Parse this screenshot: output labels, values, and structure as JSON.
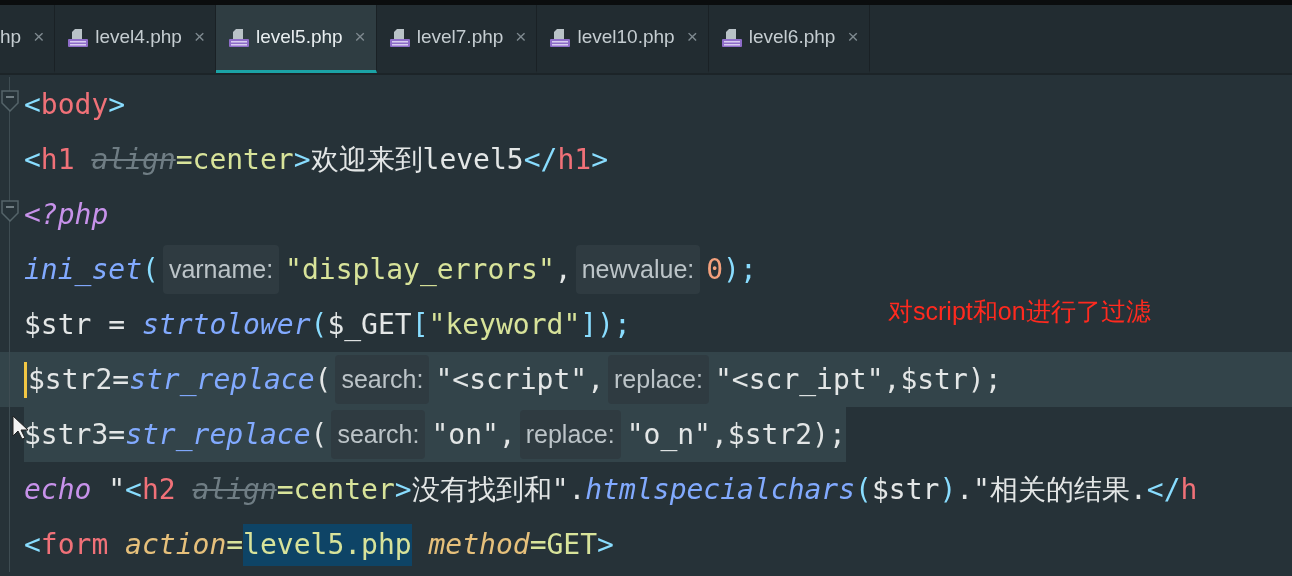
{
  "tabs": [
    {
      "label": "hp",
      "close": "×",
      "selected": false,
      "icon": false
    },
    {
      "label": "level4.php",
      "close": "×",
      "selected": false,
      "icon": true
    },
    {
      "label": "level5.php",
      "close": "×",
      "selected": true,
      "icon": true
    },
    {
      "label": "level7.php",
      "close": "×",
      "selected": false,
      "icon": true
    },
    {
      "label": "level10.php",
      "close": "×",
      "selected": false,
      "icon": true
    },
    {
      "label": "level6.php",
      "close": "×",
      "selected": false,
      "icon": true
    }
  ],
  "code_lines": [
    {
      "fold": true,
      "current": false,
      "caret": false,
      "selected": false,
      "tokens": [
        {
          "kind": "punct",
          "text": "<"
        },
        {
          "kind": "tag",
          "text": "body"
        },
        {
          "kind": "punct",
          "text": ">"
        }
      ]
    },
    {
      "fold": false,
      "current": false,
      "caret": false,
      "selected": false,
      "tokens": [
        {
          "kind": "punct",
          "text": "<"
        },
        {
          "kind": "tag",
          "text": "h1"
        },
        {
          "kind": "deprecated",
          "text": "align",
          "space_before": true
        },
        {
          "kind": "value",
          "text": "=center"
        },
        {
          "kind": "punct",
          "text": ">"
        },
        {
          "kind": "text",
          "text": "欢迎来到level5"
        },
        {
          "kind": "punct",
          "text": "</"
        },
        {
          "kind": "tag",
          "text": "h1"
        },
        {
          "kind": "punct",
          "text": ">"
        }
      ]
    },
    {
      "fold": true,
      "current": false,
      "caret": false,
      "selected": false,
      "tokens": [
        {
          "kind": "keyword",
          "text": "<?php"
        }
      ]
    },
    {
      "fold": false,
      "current": false,
      "caret": false,
      "selected": false,
      "tokens": [
        {
          "kind": "func",
          "text": "ini_set"
        },
        {
          "kind": "punct",
          "text": "("
        },
        {
          "kind": "hint",
          "text": "varname:"
        },
        {
          "kind": "string",
          "text": "\"display_errors\""
        },
        {
          "kind": "text",
          "text": ","
        },
        {
          "kind": "hint",
          "text": "newvalue:",
          "space_before": true
        },
        {
          "kind": "number",
          "text": "0"
        },
        {
          "kind": "punct",
          "text": ");"
        }
      ]
    },
    {
      "fold": false,
      "current": false,
      "caret": false,
      "selected": false,
      "tokens": [
        {
          "kind": "text",
          "text": "$str ="
        },
        {
          "kind": "func",
          "text": "strtolower",
          "space_before": true
        },
        {
          "kind": "punct",
          "text": "("
        },
        {
          "kind": "text",
          "text": "$_GET"
        },
        {
          "kind": "punct",
          "text": "["
        },
        {
          "kind": "string",
          "text": "\"keyword\""
        },
        {
          "kind": "punct",
          "text": "]);"
        }
      ]
    },
    {
      "fold": false,
      "current": true,
      "caret": true,
      "selected": true,
      "tokens": [
        {
          "kind": "text",
          "text": "$str2="
        },
        {
          "kind": "func",
          "text": "str_replace"
        },
        {
          "kind": "text",
          "text": "("
        },
        {
          "kind": "hint",
          "text": "search:"
        },
        {
          "kind": "text",
          "text": "\"<script\","
        },
        {
          "kind": "hint",
          "text": "replace:"
        },
        {
          "kind": "text",
          "text": "\"<scr_ipt\",$str);"
        }
      ]
    },
    {
      "fold": false,
      "current": false,
      "caret": false,
      "selected": true,
      "tokens": [
        {
          "kind": "text",
          "text": "$str3="
        },
        {
          "kind": "func",
          "text": "str_replace"
        },
        {
          "kind": "text",
          "text": "("
        },
        {
          "kind": "hint",
          "text": "search:"
        },
        {
          "kind": "text",
          "text": "\"on\","
        },
        {
          "kind": "hint",
          "text": "replace:"
        },
        {
          "kind": "text",
          "text": "\"o_n\",$str2);"
        }
      ]
    },
    {
      "fold": false,
      "current": false,
      "caret": false,
      "selected": false,
      "tokens": [
        {
          "kind": "keyword",
          "text": "echo"
        },
        {
          "kind": "text",
          "text": "\"",
          "space_before": true
        },
        {
          "kind": "punct",
          "text": "<"
        },
        {
          "kind": "tag",
          "text": "h2"
        },
        {
          "kind": "deprecated",
          "text": "align",
          "space_before": true
        },
        {
          "kind": "value",
          "text": "=center"
        },
        {
          "kind": "punct",
          "text": ">"
        },
        {
          "kind": "text",
          "text": "没有找到和\"."
        },
        {
          "kind": "func",
          "text": "htmlspecialchars"
        },
        {
          "kind": "punct",
          "text": "("
        },
        {
          "kind": "text",
          "text": "$str"
        },
        {
          "kind": "punct",
          "text": ")"
        },
        {
          "kind": "text",
          "text": ".\"相关的结果."
        },
        {
          "kind": "punct",
          "text": "</"
        },
        {
          "kind": "tag",
          "text": "h"
        }
      ]
    },
    {
      "fold": false,
      "current": false,
      "caret": false,
      "selected": false,
      "tokens": [
        {
          "kind": "punct",
          "text": "<"
        },
        {
          "kind": "tag",
          "text": "form"
        },
        {
          "kind": "attr",
          "text": "action",
          "space_before": true
        },
        {
          "kind": "value",
          "text": "="
        },
        {
          "kind": "highlighted",
          "text": "level5.php"
        },
        {
          "kind": "attr",
          "text": "method",
          "space_before": true
        },
        {
          "kind": "value",
          "text": "=GET"
        },
        {
          "kind": "punct",
          "text": ">"
        }
      ]
    }
  ],
  "annotation": "对script和on进行了过滤"
}
